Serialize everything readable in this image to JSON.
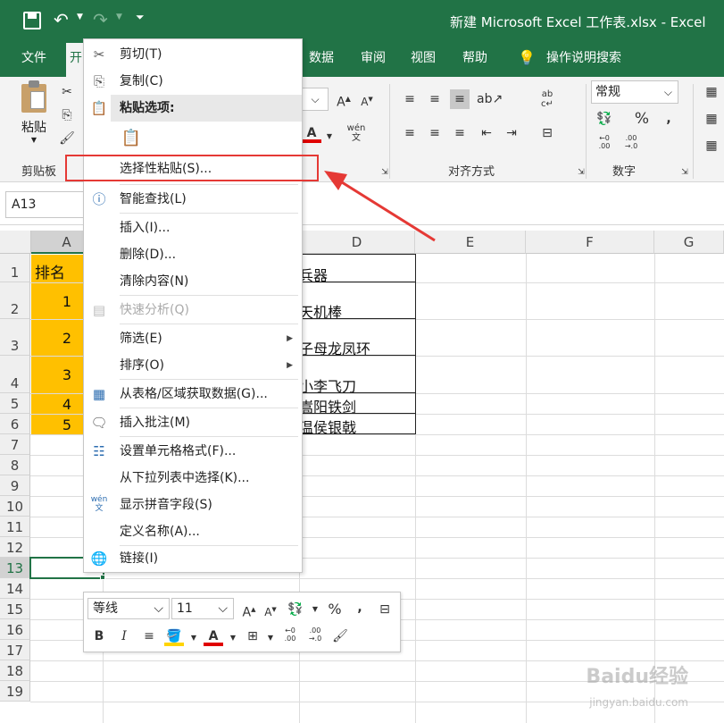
{
  "window": {
    "title": "新建 Microsoft Excel 工作表.xlsx",
    "app": "Excel"
  },
  "tabs": [
    "文件",
    "开",
    "数据",
    "审阅",
    "视图",
    "帮助",
    "操作说明搜索"
  ],
  "ribbon": {
    "clipboard": {
      "paste_label": "粘贴",
      "group": "剪贴板"
    },
    "align_group": "对齐方式",
    "number_group": "数字",
    "number_format": "常规"
  },
  "name_box": "A13",
  "columns": [
    "A",
    "D",
    "E",
    "F",
    "G"
  ],
  "rows": [
    "1",
    "2",
    "3",
    "4",
    "5",
    "6",
    "7",
    "8",
    "9",
    "10",
    "11",
    "12",
    "13",
    "14",
    "15",
    "16",
    "17",
    "18",
    "19"
  ],
  "cells": {
    "a": [
      "排名",
      "1",
      "2",
      "3",
      "4",
      "5"
    ],
    "d": [
      "兵器",
      "天机棒",
      "子母龙凤环",
      "小李飞刀",
      "嵩阳铁剑",
      "温侯银戟"
    ]
  },
  "context_menu": {
    "cut": "剪切(T)",
    "copy": "复制(C)",
    "paste_options": "粘贴选项:",
    "paste_special": "选择性粘贴(S)...",
    "smart_lookup": "智能查找(L)",
    "insert": "插入(I)...",
    "delete": "删除(D)...",
    "clear": "清除内容(N)",
    "quick_analysis": "快速分析(Q)",
    "filter": "筛选(E)",
    "sort": "排序(O)",
    "get_data": "从表格/区域获取数据(G)...",
    "insert_comment": "插入批注(M)",
    "format_cells": "设置单元格格式(F)...",
    "pick_list": "从下拉列表中选择(K)...",
    "phonetic": "显示拼音字段(S)",
    "define_name": "定义名称(A)...",
    "link": "链接(I)"
  },
  "mini_toolbar": {
    "font": "等线",
    "size": "11"
  },
  "watermark": {
    "brand": "Baidu经验",
    "url": "jingyan.baidu.com"
  },
  "colors": {
    "excel_green": "#217346",
    "highlight": "#ffc000",
    "annotation": "#e53935"
  }
}
